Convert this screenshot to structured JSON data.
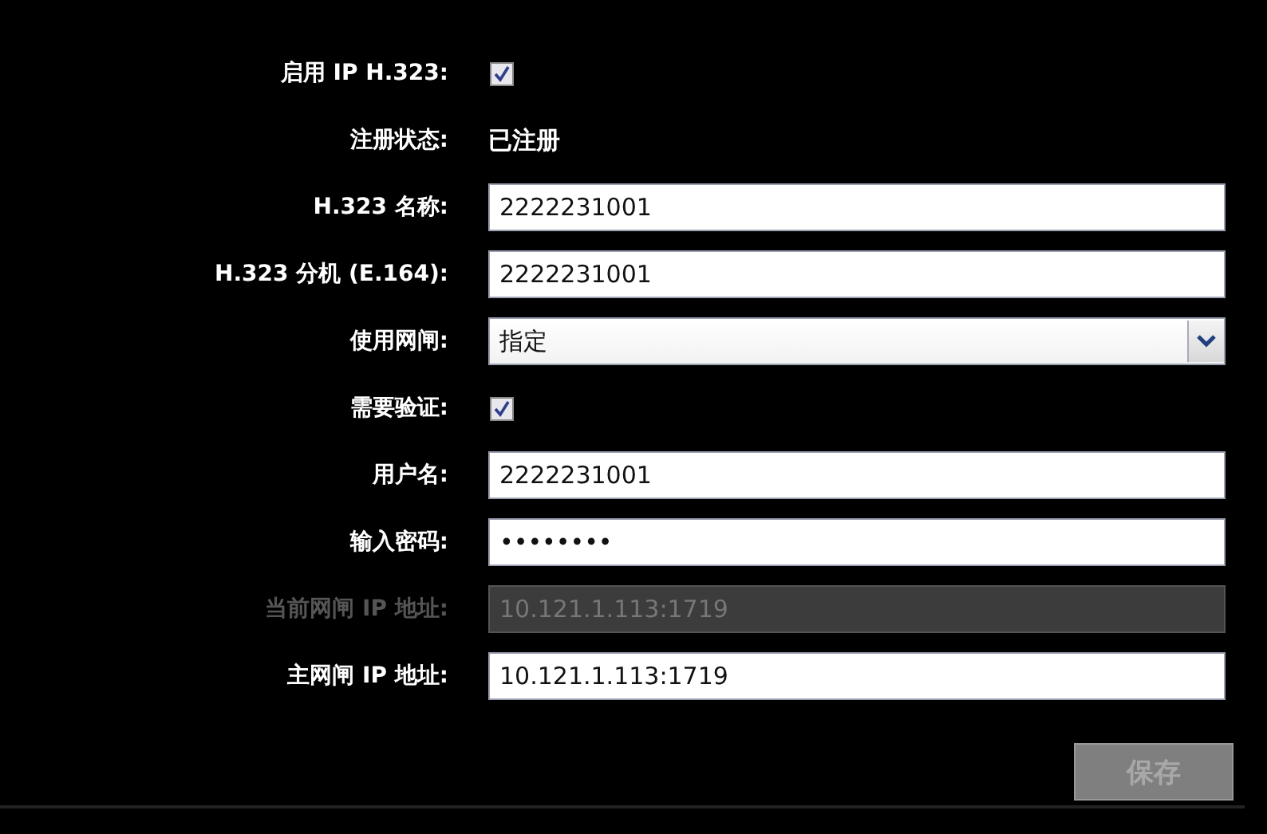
{
  "form": {
    "rows": [
      {
        "kind": "checkbox",
        "label": "启用 IP H.323:",
        "checked": true
      },
      {
        "kind": "text",
        "label": "注册状态:",
        "value": "已注册"
      },
      {
        "kind": "field",
        "label": "H.323 名称:",
        "value": "2222231001",
        "disabled": false
      },
      {
        "kind": "field",
        "label": "H.323 分机 (E.164):",
        "value": "2222231001",
        "disabled": false
      },
      {
        "kind": "dropdown",
        "label": "使用网闸:",
        "value": "指定"
      },
      {
        "kind": "checkbox",
        "label": "需要验证:",
        "checked": true
      },
      {
        "kind": "field",
        "label": "用户名:",
        "value": "2222231001",
        "disabled": false
      },
      {
        "kind": "field",
        "label": "输入密码:",
        "value": "••••••••",
        "disabled": false
      },
      {
        "kind": "field",
        "label": "当前网闸 IP 地址:",
        "value": "10.121.1.113:1719",
        "disabled": true
      },
      {
        "kind": "field",
        "label": "主网闸 IP 地址:",
        "value": "10.121.1.113:1719",
        "disabled": false
      }
    ]
  },
  "save_button": {
    "label": "保存",
    "disabled": true
  }
}
